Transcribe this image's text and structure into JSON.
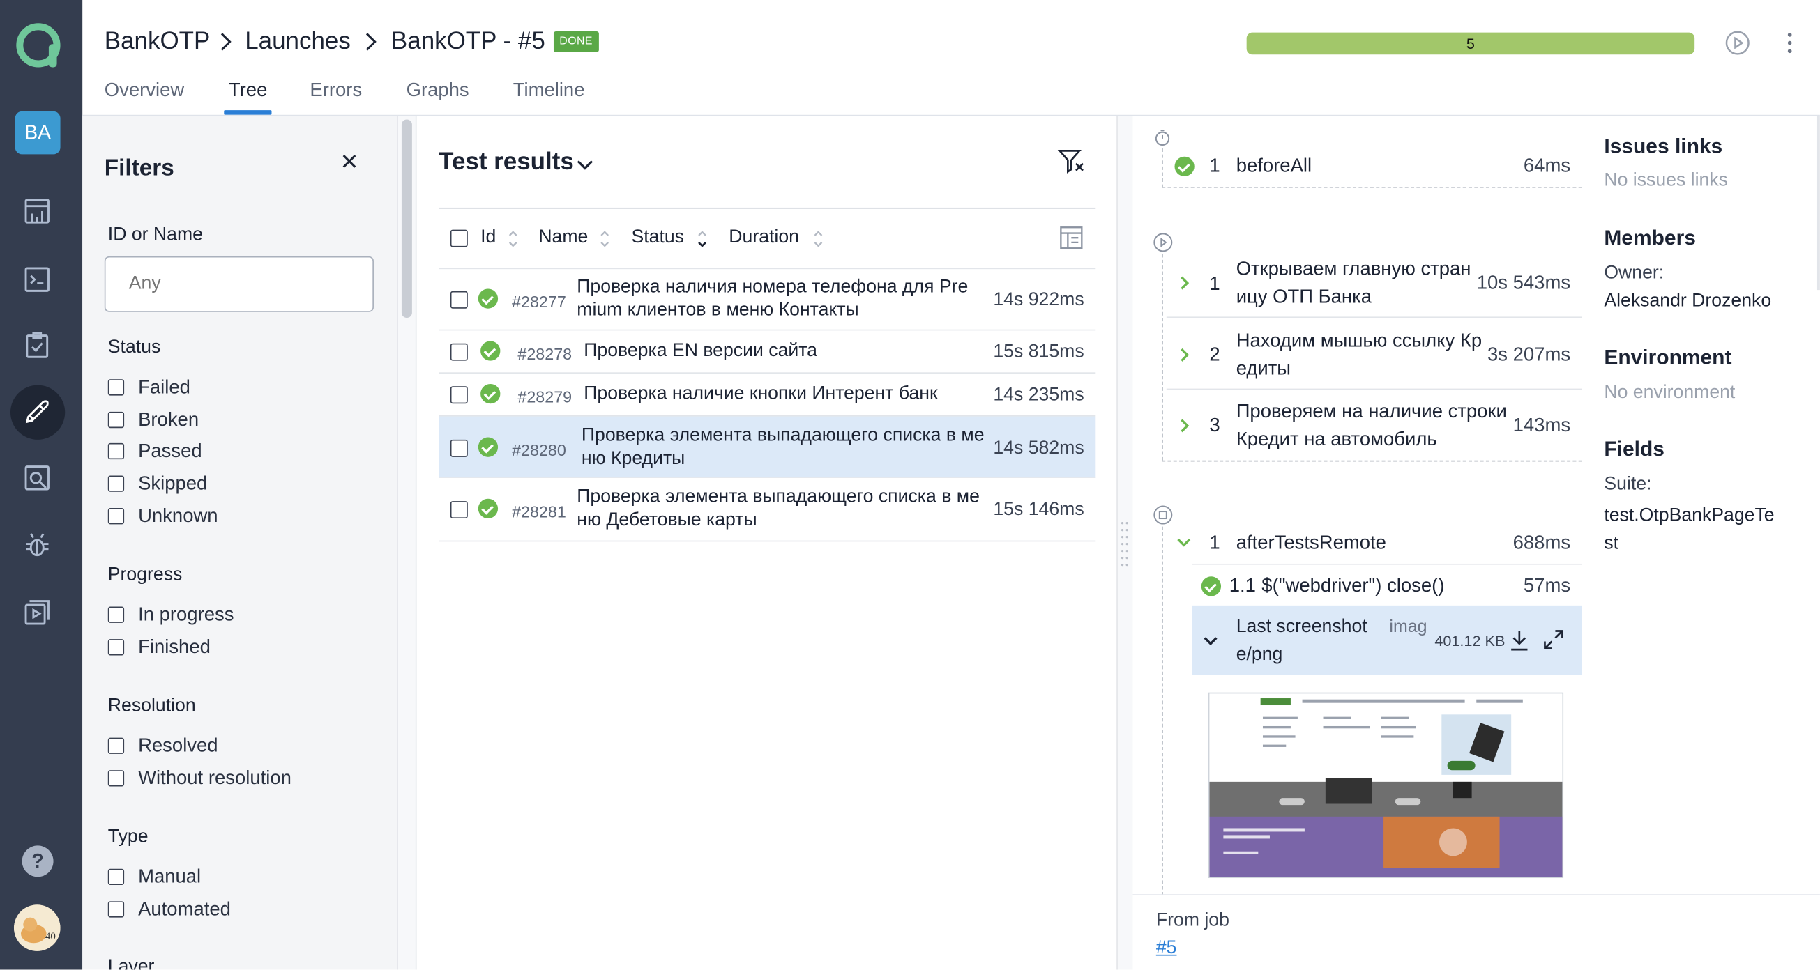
{
  "breadcrumb": {
    "project": "BankOTP",
    "launches": "Launches",
    "launch": "BankOTP - #5",
    "status_badge": "DONE"
  },
  "progress": {
    "label": "5",
    "fraction": 1.0,
    "color": "#a2c76a"
  },
  "user": {
    "initials": "BA"
  },
  "tabs": [
    {
      "label": "Overview"
    },
    {
      "label": "Tree"
    },
    {
      "label": "Errors"
    },
    {
      "label": "Graphs"
    },
    {
      "label": "Timeline"
    }
  ],
  "filters": {
    "title": "Filters",
    "id_label": "ID or Name",
    "id_placeholder": "Any",
    "status_label": "Status",
    "status_options": [
      "Failed",
      "Broken",
      "Passed",
      "Skipped",
      "Unknown"
    ],
    "progress_label": "Progress",
    "progress_options": [
      "In progress",
      "Finished"
    ],
    "resolution_label": "Resolution",
    "resolution_options": [
      "Resolved",
      "Without resolution"
    ],
    "type_label": "Type",
    "type_options": [
      "Manual",
      "Automated"
    ],
    "layer_label": "Layer"
  },
  "results": {
    "title": "Test results",
    "columns": {
      "id": "Id",
      "name": "Name",
      "status": "Status",
      "duration": "Duration"
    },
    "rows": [
      {
        "id": "#28277",
        "name_line1": "Проверка наличия номера телефона для Pre",
        "name_line2": "mium клиентов в меню Контакты",
        "duration": "14s 922ms"
      },
      {
        "id": "#28278",
        "name_line1": "Проверка EN версии сайта",
        "name_line2": "",
        "duration": "15s 815ms"
      },
      {
        "id": "#28279",
        "name_line1": "Проверка наличие кнопки Интерент банк",
        "name_line2": "",
        "duration": "14s 235ms"
      },
      {
        "id": "#28280",
        "name_line1": "Проверка элемента выпадающего списка в ме",
        "name_line2": "ню Кредиты",
        "duration": "14s 582ms"
      },
      {
        "id": "#28281",
        "name_line1": "Проверка элемента выпадающего списка в ме",
        "name_line2": "ню Дебетовые карты",
        "duration": "15s 146ms"
      }
    ]
  },
  "details": {
    "before": {
      "n": "1",
      "title": "beforeAll",
      "duration": "64ms"
    },
    "steps": [
      {
        "n": "1",
        "line1": "Открываем главную стран",
        "line2": "ицу ОТП Банка",
        "duration": "10s 543ms"
      },
      {
        "n": "2",
        "line1": "Находим мышью ссылку Кр",
        "line2": "едиты",
        "duration": "3s 207ms"
      },
      {
        "n": "3",
        "line1": "Проверяем на наличие строки",
        "line2": "Кредит на автомобиль",
        "duration": "143ms"
      }
    ],
    "after": {
      "n": "1",
      "title": "afterTestsRemote",
      "duration": "688ms"
    },
    "after_sub": {
      "n": "1.1",
      "title": "$(\"webdriver\") close()",
      "duration": "57ms"
    },
    "attachment": {
      "line1": "Last screenshot",
      "line2": "e/png",
      "type_part": "imag",
      "size": "401.12 KB"
    },
    "from_job_label": "From job",
    "from_job_link": "#5"
  },
  "side": {
    "issues_title": "Issues links",
    "issues_value": "No issues links",
    "members_title": "Members",
    "owner_label": "Owner:",
    "owner_value": "Aleksandr Drozenko",
    "environment_title": "Environment",
    "environment_value": "No environment",
    "fields_title": "Fields",
    "suite_label": "Suite:",
    "suite_line1": "test.OtpBankPageTe",
    "suite_line2": "st"
  },
  "colors": {
    "nav_bg": "#343d4f",
    "accent": "#2a7ed6",
    "passed": "#6bb84d",
    "done_badge": "#5aa846",
    "selected_row": "#dce9f8"
  }
}
